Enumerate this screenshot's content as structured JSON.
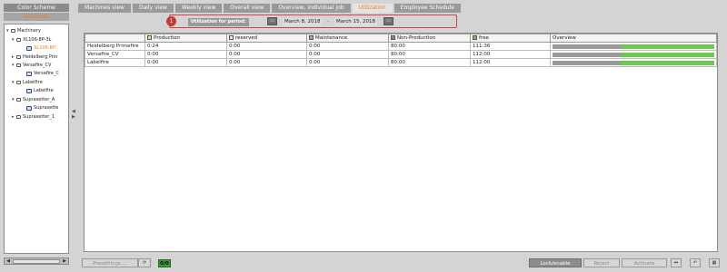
{
  "left_panel": {
    "tab_color_scheme": "Color Scheme",
    "tab_machines": "Machines",
    "tree": [
      {
        "label": "Machinery"
      },
      {
        "label": "XL106-8P-3L"
      },
      {
        "label": "XL106-8P-"
      },
      {
        "label": "Heidelberg Prin"
      },
      {
        "label": "Versafire_CV"
      },
      {
        "label": "Versafire_C"
      },
      {
        "label": "Labelfire"
      },
      {
        "label": "Labelfire"
      },
      {
        "label": "Suprasetter_A"
      },
      {
        "label": "Suprasette"
      },
      {
        "label": "Suprasetter_1"
      }
    ],
    "scroll_left": "◀",
    "scroll_right": "▶",
    "splitter_left": "◀",
    "splitter_right": "▶"
  },
  "tabs": [
    "Machines view",
    "Daily view",
    "Weekly view",
    "Overall view",
    "Overview, individual job",
    "Utilization",
    "Employee Schedule"
  ],
  "active_tab": "Utilization",
  "period": {
    "badge": "1",
    "label": "Utilization for period:",
    "start": "March 8, 2018",
    "separator": "-",
    "end": "March 15, 2018",
    "calendar_icon": "calendar-icon"
  },
  "table": {
    "columns": [
      {
        "label": "",
        "swatch": ""
      },
      {
        "label": "Production",
        "swatch": "#e8e07a"
      },
      {
        "label": "reserved",
        "swatch": "#f0dfe6"
      },
      {
        "label": "Maintenance",
        "swatch": "#a79ad8"
      },
      {
        "label": "Non-Production",
        "swatch": "#8a8a8a"
      },
      {
        "label": "free",
        "swatch": "#6cc84f"
      },
      {
        "label": "Overview",
        "swatch": ""
      }
    ],
    "rows": [
      {
        "name": "Heidelberg Primefire",
        "production": "0:24",
        "reserved": "0:00",
        "maintenance": "0:00",
        "non_production": "80:00",
        "free": "111:36",
        "used_fraction": 0.42
      },
      {
        "name": "Versafire_CV",
        "production": "0:00",
        "reserved": "0:00",
        "maintenance": "0:00",
        "non_production": "80:00",
        "free": "112:00",
        "used_fraction": 0.42
      },
      {
        "name": "Labelfire",
        "production": "0:00",
        "reserved": "0:00",
        "maintenance": "0:00",
        "non_production": "80:00",
        "free": "112:00",
        "used_fraction": 0.42
      }
    ]
  },
  "bottom": {
    "presettings": "Presettings ...",
    "refresh_icon": "refresh-icon",
    "status_badge": "0/0",
    "lock_enable": "Lock/enable",
    "reject": "Reject",
    "activate": "Activate",
    "first_icon": "first-page-icon",
    "undo_icon": "undo-icon",
    "grid_icon": "grid-icon"
  },
  "colors": {
    "accent": "#f07c1c",
    "highlight": "#d94040",
    "free": "#6cc84f",
    "non_production": "#9a9a9a"
  }
}
